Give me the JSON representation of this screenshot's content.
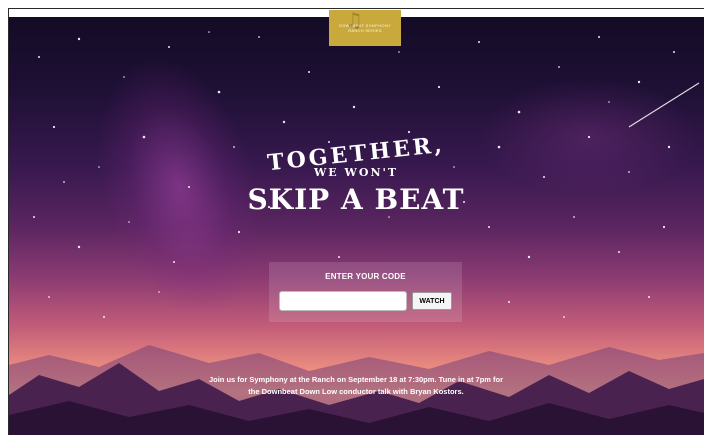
{
  "logo": {
    "text_line1": "DOWNBEAT SYMPHONY",
    "text_line2": "RANCH SERIES",
    "icon": "music-note-icon",
    "background_color": "#c9a93b"
  },
  "headline": {
    "line1": "TOGETHER,",
    "line2": "WE WON'T",
    "line3": "SKIP A BEAT"
  },
  "code_entry": {
    "title": "ENTER YOUR CODE",
    "input_value": "",
    "input_placeholder": "",
    "button_label": "WATCH"
  },
  "footer": {
    "message": "Join us for Symphony at the Ranch on September 18 at 7:30pm. Tune in at 7pm for the Downbeat Down Low conductor talk with Bryan Kostors."
  },
  "colors": {
    "sky_top": "#140b25",
    "sky_horizon": "#f6b08a",
    "text": "#ffffff"
  }
}
